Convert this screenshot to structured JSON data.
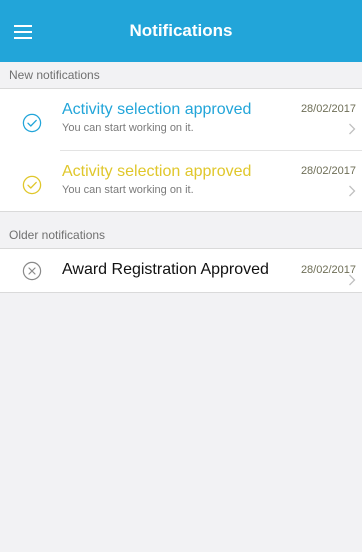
{
  "header": {
    "title": "Notifications"
  },
  "colors": {
    "header_bg": "#22a5d9",
    "blue": "#22a5d9",
    "yellow": "#e0c72b",
    "gray_icon": "#8a8a8a"
  },
  "sections": {
    "new_label": "New notifications",
    "older_label": "Older notifications"
  },
  "new_notifications": [
    {
      "title": "Activity selection approved",
      "subtitle": "You can start working on it.",
      "date": "28/02/2017",
      "status_icon": "check-circle-icon",
      "accent": "#22a5d9"
    },
    {
      "title": "Activity selection approved",
      "subtitle": "You can start working on it.",
      "date": "28/02/2017",
      "status_icon": "check-circle-icon",
      "accent": "#e0c72b"
    }
  ],
  "older_notifications": [
    {
      "title": "Award Registration Approved",
      "date": "28/02/2017",
      "status_icon": "close-circle-icon"
    }
  ]
}
